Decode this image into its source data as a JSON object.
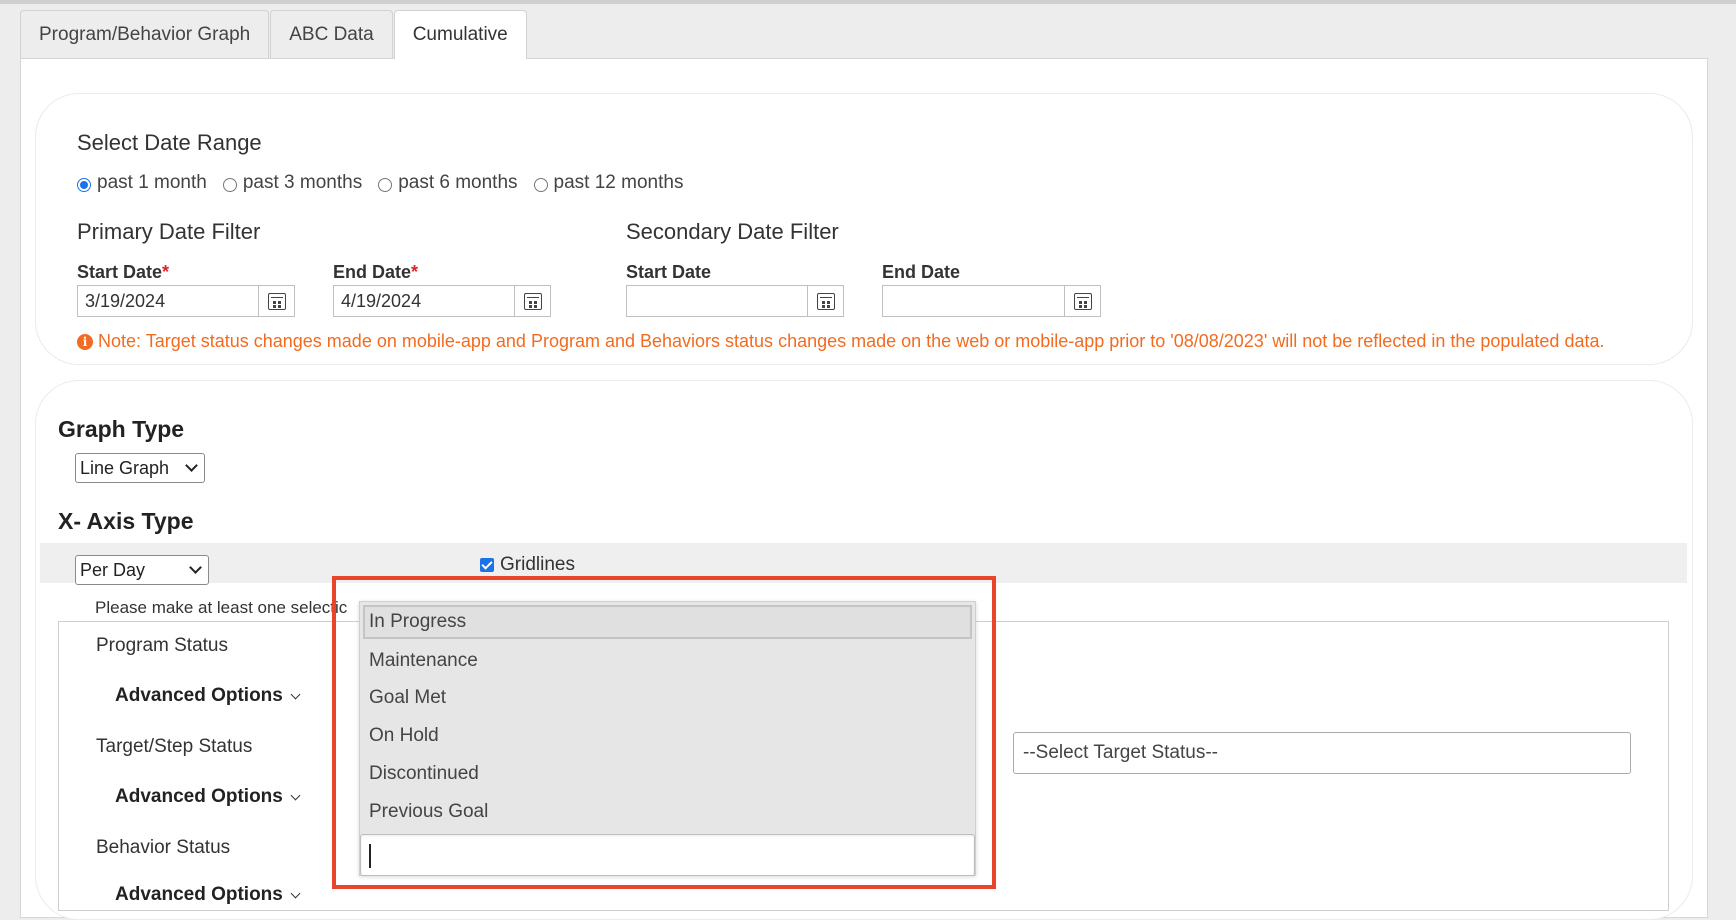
{
  "tabs": [
    {
      "label": "Program/Behavior Graph",
      "active": false
    },
    {
      "label": "ABC Data",
      "active": false
    },
    {
      "label": "Cumulative",
      "active": true
    }
  ],
  "date_range": {
    "title": "Select Date Range",
    "options": [
      {
        "label": "past 1 month",
        "checked": true
      },
      {
        "label": "past 3 months",
        "checked": false
      },
      {
        "label": "past 6 months",
        "checked": false
      },
      {
        "label": "past 12 months",
        "checked": false
      }
    ]
  },
  "primary_filter": {
    "title": "Primary Date Filter",
    "start_label": "Start Date",
    "start_value": "3/19/2024",
    "end_label": "End Date",
    "end_value": "4/19/2024",
    "required_mark": "*"
  },
  "secondary_filter": {
    "title": "Secondary Date Filter",
    "start_label": "Start Date",
    "start_value": "",
    "end_label": "End Date",
    "end_value": ""
  },
  "note": {
    "icon": "info-icon",
    "text": "Note: Target status changes made on mobile-app and Program and Behaviors status changes made on the web or mobile-app prior to '08/08/2023' will not be reflected in the populated data."
  },
  "graph_type": {
    "title": "Graph Type",
    "selected": "Line Graph"
  },
  "x_axis": {
    "title": "X- Axis Type",
    "selected": "Per Day",
    "gridlines_label": "Gridlines",
    "gridlines_checked": true
  },
  "hint": "Please make at least one selectic",
  "statuses": {
    "program_label": "Program Status",
    "target_label": "Target/Step Status",
    "behavior_label": "Behavior Status",
    "advanced_label": "Advanced Options",
    "target_placeholder": "--Select Target Status--"
  },
  "dropdown": {
    "items": [
      {
        "label": "In Progress",
        "selected": true
      },
      {
        "label": "Maintenance",
        "selected": false
      },
      {
        "label": "Goal Met",
        "selected": false
      },
      {
        "label": "On Hold",
        "selected": false
      },
      {
        "label": "Discontinued",
        "selected": false
      },
      {
        "label": "Previous Goal",
        "selected": false
      }
    ],
    "search_value": ""
  },
  "colors": {
    "accent": "#1a73e8",
    "note": "#f26b21",
    "required": "#d9232d",
    "highlight": "#e8462a"
  }
}
